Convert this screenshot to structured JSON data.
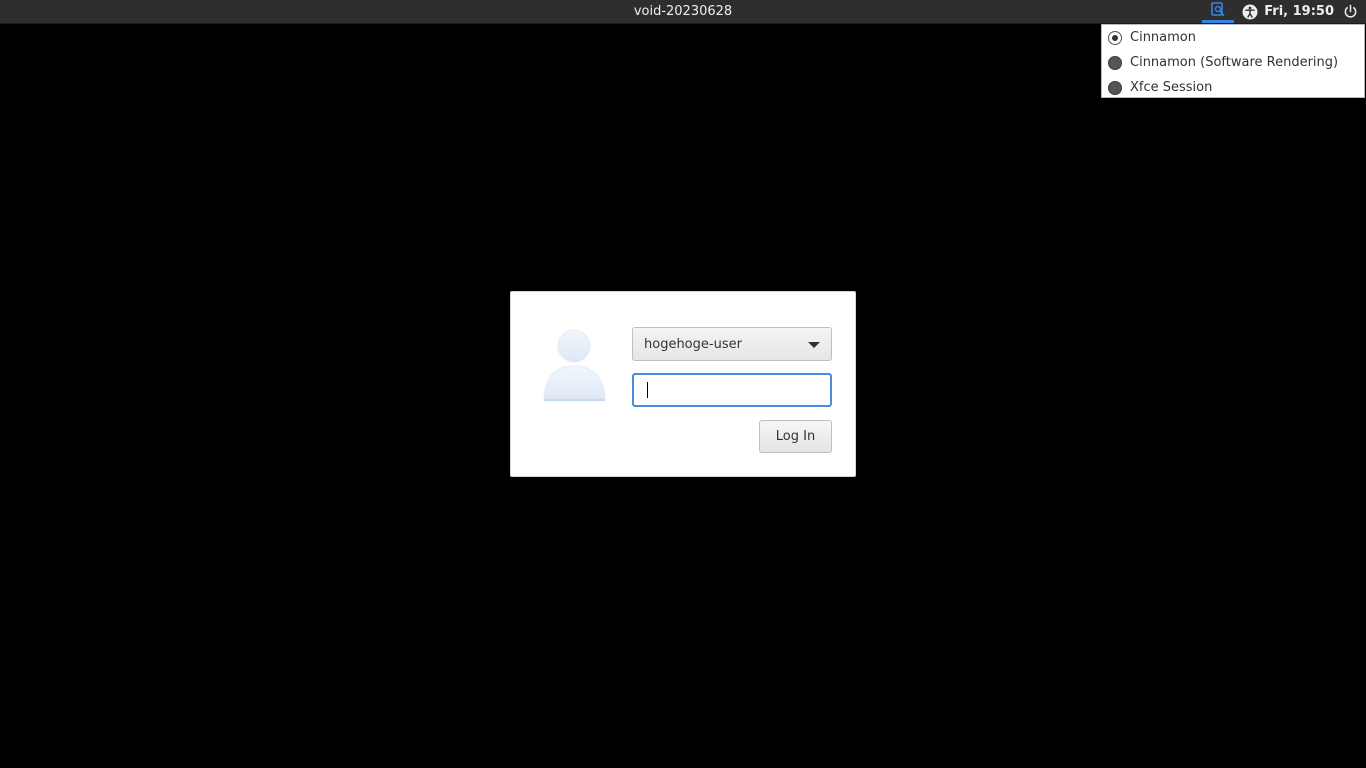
{
  "topbar": {
    "hostname": "void-20230628",
    "clock": "Fri, 19:50",
    "icons": {
      "session": "session-select-icon",
      "accessibility": "accessibility-icon",
      "power": "power-icon"
    },
    "accent_color": "#3584e4"
  },
  "session_menu": {
    "items": [
      {
        "label": "Cinnamon",
        "selected": true
      },
      {
        "label": "Cinnamon (Software Rendering)",
        "selected": false
      },
      {
        "label": "Xfce Session",
        "selected": false
      }
    ]
  },
  "login": {
    "user": "hogehoge-user",
    "password_value": "",
    "login_label": "Log In",
    "focus_color": "#4a90d9"
  }
}
